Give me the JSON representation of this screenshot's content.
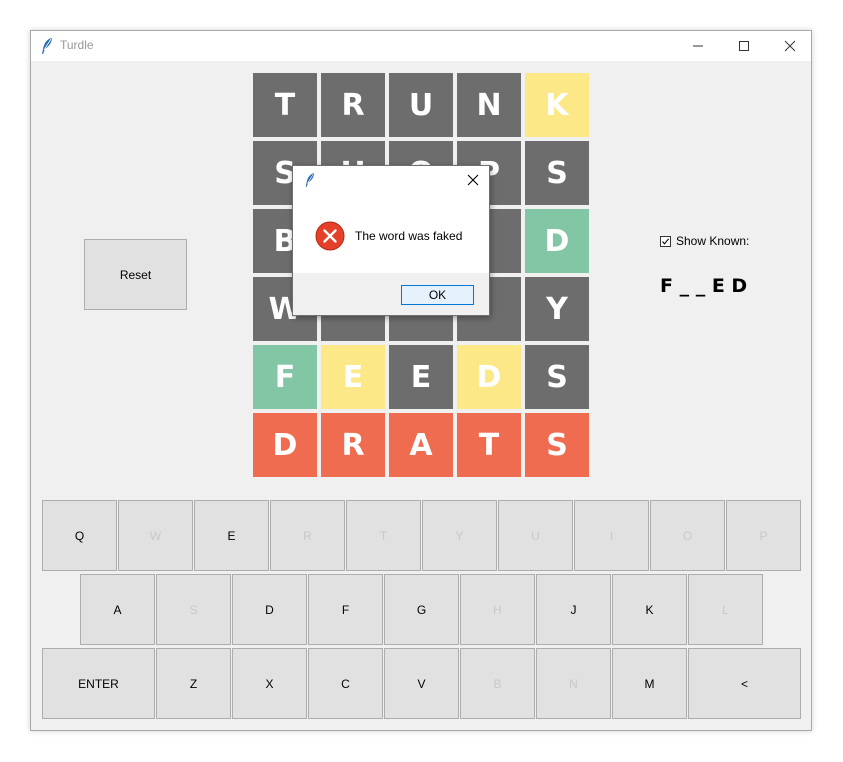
{
  "window": {
    "title": "Turdle"
  },
  "grid": [
    [
      {
        "l": "T",
        "s": "gray"
      },
      {
        "l": "R",
        "s": "gray"
      },
      {
        "l": "U",
        "s": "gray"
      },
      {
        "l": "N",
        "s": "gray"
      },
      {
        "l": "K",
        "s": "yellow"
      }
    ],
    [
      {
        "l": "S",
        "s": "gray"
      },
      {
        "l": "H",
        "s": "gray"
      },
      {
        "l": "O",
        "s": "gray"
      },
      {
        "l": "P",
        "s": "gray"
      },
      {
        "l": "S",
        "s": "gray"
      }
    ],
    [
      {
        "l": "B",
        "s": "gray"
      },
      {
        "l": "",
        "s": "gray"
      },
      {
        "l": "",
        "s": "gray"
      },
      {
        "l": "",
        "s": "gray"
      },
      {
        "l": "D",
        "s": "green"
      }
    ],
    [
      {
        "l": "W",
        "s": "gray"
      },
      {
        "l": "",
        "s": "gray"
      },
      {
        "l": "",
        "s": "gray"
      },
      {
        "l": "",
        "s": "gray"
      },
      {
        "l": "Y",
        "s": "gray"
      }
    ],
    [
      {
        "l": "F",
        "s": "green"
      },
      {
        "l": "E",
        "s": "yellow"
      },
      {
        "l": "E",
        "s": "gray"
      },
      {
        "l": "D",
        "s": "yellow"
      },
      {
        "l": "S",
        "s": "gray"
      }
    ],
    [
      {
        "l": "D",
        "s": "red"
      },
      {
        "l": "R",
        "s": "red"
      },
      {
        "l": "A",
        "s": "red"
      },
      {
        "l": "T",
        "s": "red"
      },
      {
        "l": "S",
        "s": "red"
      }
    ]
  ],
  "controls": {
    "reset_label": "Reset",
    "show_known_label": "Show Known:",
    "show_known_checked": true,
    "known_word": "F _ _ E D"
  },
  "keyboard": {
    "row1": [
      {
        "label": "Q",
        "used": false
      },
      {
        "label": "W",
        "used": true
      },
      {
        "label": "E",
        "used": false
      },
      {
        "label": "R",
        "used": true
      },
      {
        "label": "T",
        "used": true
      },
      {
        "label": "Y",
        "used": true
      },
      {
        "label": "U",
        "used": true
      },
      {
        "label": "I",
        "used": true
      },
      {
        "label": "O",
        "used": true
      },
      {
        "label": "P",
        "used": true
      }
    ],
    "row2": [
      {
        "label": "A",
        "used": false
      },
      {
        "label": "S",
        "used": true
      },
      {
        "label": "D",
        "used": false
      },
      {
        "label": "F",
        "used": false
      },
      {
        "label": "G",
        "used": false
      },
      {
        "label": "H",
        "used": true
      },
      {
        "label": "J",
        "used": false
      },
      {
        "label": "K",
        "used": false
      },
      {
        "label": "L",
        "used": true
      }
    ],
    "row3": [
      {
        "label": "ENTER",
        "used": false
      },
      {
        "label": "Z",
        "used": false
      },
      {
        "label": "X",
        "used": false
      },
      {
        "label": "C",
        "used": false
      },
      {
        "label": "V",
        "used": false
      },
      {
        "label": "B",
        "used": true
      },
      {
        "label": "N",
        "used": true
      },
      {
        "label": "M",
        "used": false
      },
      {
        "label": "<",
        "used": false
      }
    ]
  },
  "dialog": {
    "message": "The word was faked",
    "ok_label": "OK"
  },
  "colors": {
    "gray": "#6d6d6d",
    "yellow": "#fde887",
    "green": "#83c6a5",
    "red": "#f06c50",
    "key_used_text": "#c9c9c9"
  },
  "icons": {
    "app": "feather-icon",
    "error": "error-icon",
    "close": "close-icon"
  }
}
